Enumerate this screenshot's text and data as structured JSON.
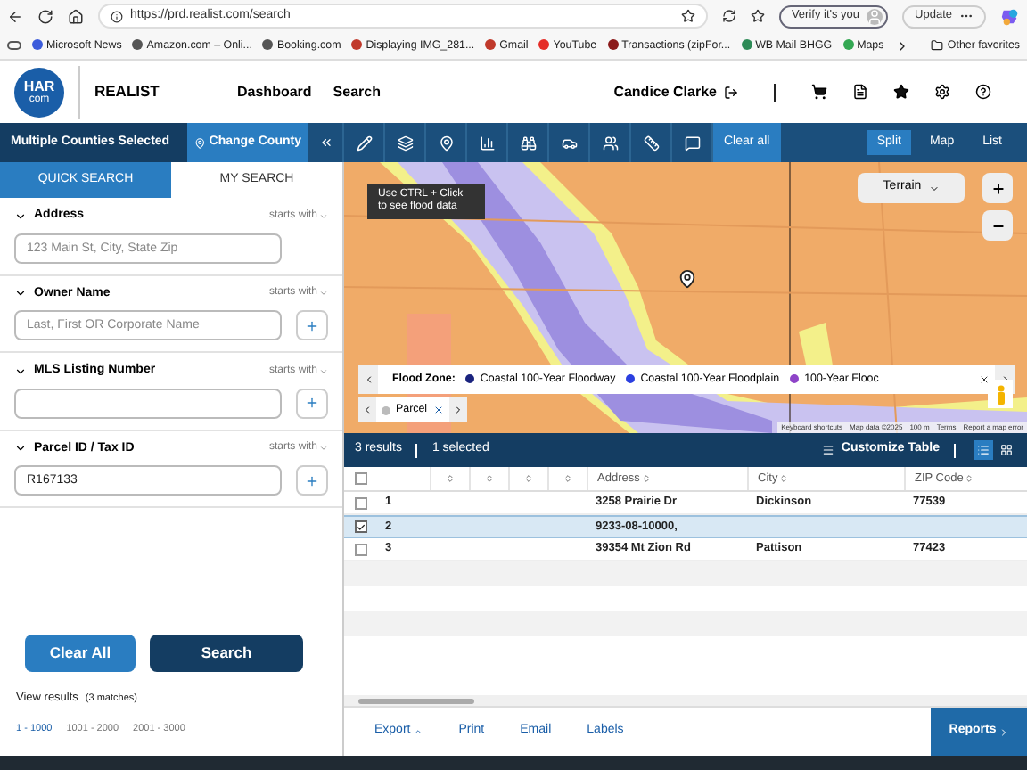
{
  "browser": {
    "url": "https://prd.realist.com/search",
    "verify_label": "Verify it's you",
    "update_label": "Update",
    "bookmarks": [
      {
        "label": "Microsoft News",
        "color": "#3b5bdb"
      },
      {
        "label": "Amazon.com – Onli...",
        "color": "#555555"
      },
      {
        "label": "Booking.com",
        "color": "#555555"
      },
      {
        "label": "Displaying IMG_281...",
        "color": "#c0392b"
      },
      {
        "label": "Gmail",
        "color": "#c0392b"
      },
      {
        "label": "YouTube",
        "color": "#e52d27"
      },
      {
        "label": "Transactions (zipFor...",
        "color": "#8b1a1a"
      },
      {
        "label": "WB Mail BHGG",
        "color": "#2e8b57"
      },
      {
        "label": "Maps",
        "color": "#34a853"
      }
    ],
    "other_favorites": "Other favorites"
  },
  "header": {
    "logo_top": "HAR",
    "logo_bottom": "com",
    "product": "REALIST",
    "nav": [
      {
        "label": "Dashboard"
      },
      {
        "label": "Search"
      }
    ],
    "user": "Candice Clarke"
  },
  "toolbar": {
    "county_label": "Multiple Counties Selected",
    "change_county": "Change County",
    "clear_all": "Clear all",
    "views": [
      {
        "label": "Split",
        "selected": true
      },
      {
        "label": "Map",
        "selected": false
      },
      {
        "label": "List",
        "selected": false
      }
    ]
  },
  "search": {
    "tabs": [
      {
        "label": "QUICK SEARCH",
        "selected": true
      },
      {
        "label": "MY SEARCH",
        "selected": false
      }
    ],
    "fields": [
      {
        "label": "Address",
        "match": "starts with",
        "expanded": true,
        "placeholder": "123 Main St, City, State Zip",
        "has_add": false
      },
      {
        "label": "Owner Name",
        "match": "starts with",
        "expanded": true,
        "placeholder": "Last, First OR Corporate Name",
        "has_add": true
      },
      {
        "label": "MLS Listing Number",
        "match": "starts with",
        "expanded": true,
        "has_add": true
      },
      {
        "label": "Parcel ID / Tax ID",
        "match": "starts with",
        "expanded": true,
        "value": "R167133",
        "has_add": true
      }
    ],
    "clear_button": "Clear All",
    "search_button": "Search",
    "view_results": "View results",
    "matches": "(3 matches)",
    "pages": [
      {
        "label": "1 - 1000",
        "selected": true
      },
      {
        "label": "1001 - 2000",
        "selected": false
      },
      {
        "label": "2001 - 3000",
        "selected": false
      }
    ]
  },
  "map": {
    "tooltip": "Use CTRL + Click to see flood data",
    "base_layer": "Terrain",
    "legend": {
      "label": "Flood Zone:",
      "items": [
        {
          "label": "Coastal 100-Year Floodway",
          "color": "#1a237e"
        },
        {
          "label": "Coastal 100-Year Floodplain",
          "color": "#2b3fe0"
        },
        {
          "label": "100-Year Flooc",
          "color": "#8e44c8"
        }
      ]
    },
    "parcel_chip": "Parcel",
    "attribution": [
      "Keyboard shortcuts",
      "Map data ©2025",
      "100 m",
      "Terms",
      "Report a map error"
    ]
  },
  "results": {
    "count": "3 results",
    "selected_count": "1 selected",
    "customize": "Customize Table",
    "layouts": [
      {
        "kind": "list",
        "selected": true
      },
      {
        "kind": "grid",
        "selected": false
      }
    ],
    "header_checked": false,
    "columns": [
      {
        "kind": "sort"
      },
      {
        "kind": "sort"
      },
      {
        "kind": "sort"
      },
      {
        "kind": "sort"
      },
      {
        "kind": "text",
        "label": "Address"
      },
      {
        "kind": "text",
        "label": "City"
      },
      {
        "kind": "text",
        "label": "ZIP Code"
      }
    ],
    "rows": [
      {
        "number": "1",
        "address": "3258 Prairie Dr",
        "city": "Dickinson",
        "zip": "77539",
        "selected": false,
        "checked": false
      },
      {
        "number": "2",
        "address": "9233-08-10000,",
        "selected": true,
        "checked": true
      },
      {
        "number": "3",
        "address": "39354 Mt Zion Rd",
        "city": "Pattison",
        "zip": "77423",
        "selected": false,
        "checked": false
      }
    ]
  },
  "footer": {
    "actions": [
      {
        "label": "Export",
        "menu": true
      },
      {
        "label": "Print",
        "menu": false
      },
      {
        "label": "Email",
        "menu": false
      },
      {
        "label": "Labels",
        "menu": false
      }
    ],
    "reports": "Reports"
  }
}
